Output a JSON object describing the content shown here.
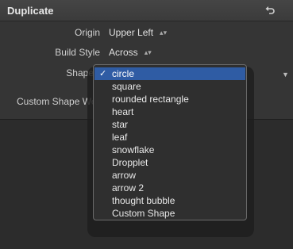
{
  "panel": {
    "title": "Duplicate",
    "reset_icon": "reset-arrow-icon"
  },
  "rows": {
    "origin": {
      "label": "Origin",
      "value": "Upper Left"
    },
    "build_style": {
      "label": "Build Style",
      "value": "Across"
    },
    "shape": {
      "label": "Shape"
    },
    "custom_shape_weight": {
      "label": "Custom Shape We"
    }
  },
  "shape_menu": {
    "selected_index": 0,
    "check_mark": "✓",
    "items": [
      "circle",
      "square",
      "rounded rectangle",
      "heart",
      "star",
      "leaf",
      "snowflake",
      "Dropplet",
      "arrow",
      "arrow 2",
      "thought bubble",
      "Custom Shape"
    ]
  },
  "colors": {
    "selection": "#2f5ca4",
    "panel": "#353535",
    "background": "#2c2c2c"
  }
}
